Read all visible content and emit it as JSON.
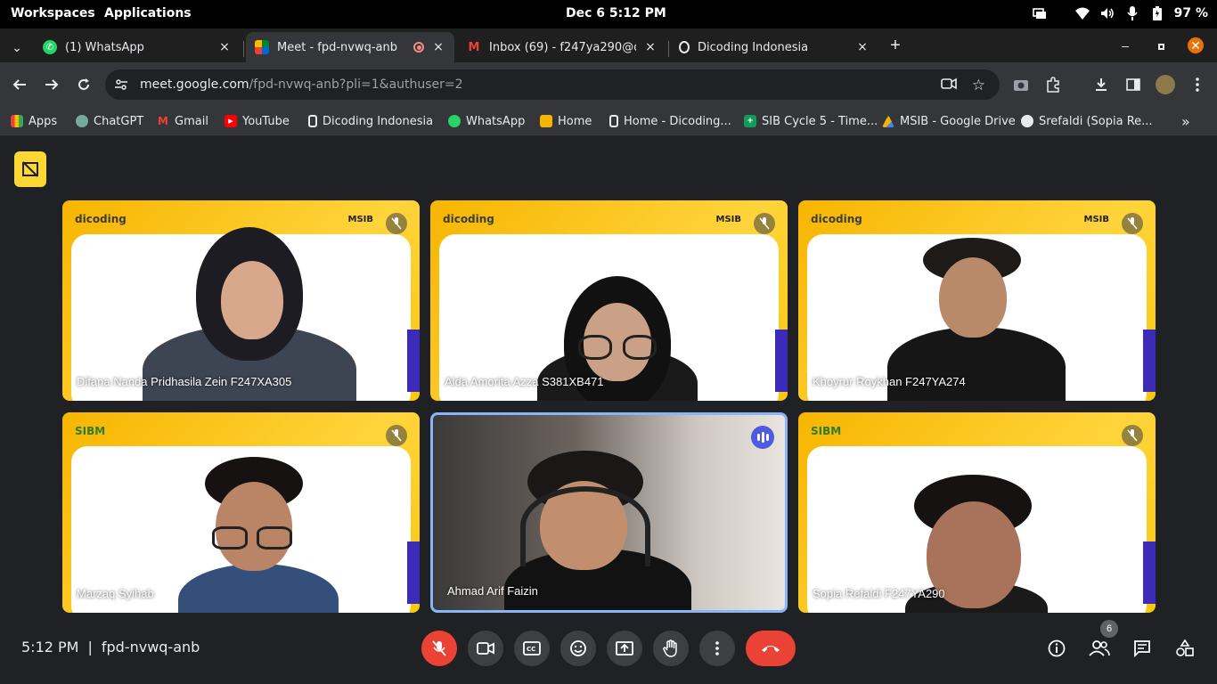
{
  "topbar": {
    "workspaces": "Workspaces",
    "applications": "Applications",
    "datetime": "Dec 6   5:12 PM",
    "battery": "97 %"
  },
  "tabs": [
    {
      "title": "(1) WhatsApp",
      "close": "×"
    },
    {
      "title": "Meet - fpd-nvwq-anb",
      "close": "×"
    },
    {
      "title": "Inbox (69) - f247ya290@dico",
      "close": "×"
    },
    {
      "title": "Dicoding Indonesia",
      "close": "×"
    }
  ],
  "new_tab": "+",
  "omnibox": {
    "host": "meet.google.com",
    "path": "/fpd-nvwq-anb?pli=1&authuser=2"
  },
  "bookmarks": [
    {
      "label": "Apps"
    },
    {
      "label": "ChatGPT"
    },
    {
      "label": "Gmail"
    },
    {
      "label": "YouTube"
    },
    {
      "label": "Dicoding Indonesia"
    },
    {
      "label": "WhatsApp"
    },
    {
      "label": "Home"
    },
    {
      "label": "Home - Dicoding..."
    },
    {
      "label": "SIB Cycle 5 - Time..."
    },
    {
      "label": "MSIB - Google Drive"
    },
    {
      "label": "Srefaldi (Sopia Re..."
    }
  ],
  "bookmarks_more": "»",
  "participants": [
    {
      "name": "Difana Nanda Pridhasila Zein F247XA305"
    },
    {
      "name": "Alda Amorita Azza S381XB471"
    },
    {
      "name": "Khoyrur Roykhan F247YA274"
    },
    {
      "name": "Marzaq Syihab"
    },
    {
      "name": "Ahmad Arif Faizin"
    },
    {
      "name": "Sopia Refaldi F247YA290"
    }
  ],
  "tile_brand": "dicoding",
  "tile_brand2": "MSIB",
  "tile_brand3": "SIBM",
  "meeting": {
    "time": "5:12 PM",
    "separator": "|",
    "code": "fpd-nvwq-anb",
    "people_count": "6"
  },
  "colors": {
    "accent_red": "#ea4335",
    "speaking_border": "#8ab4f8",
    "tile_yellow": "#ffd43b"
  }
}
